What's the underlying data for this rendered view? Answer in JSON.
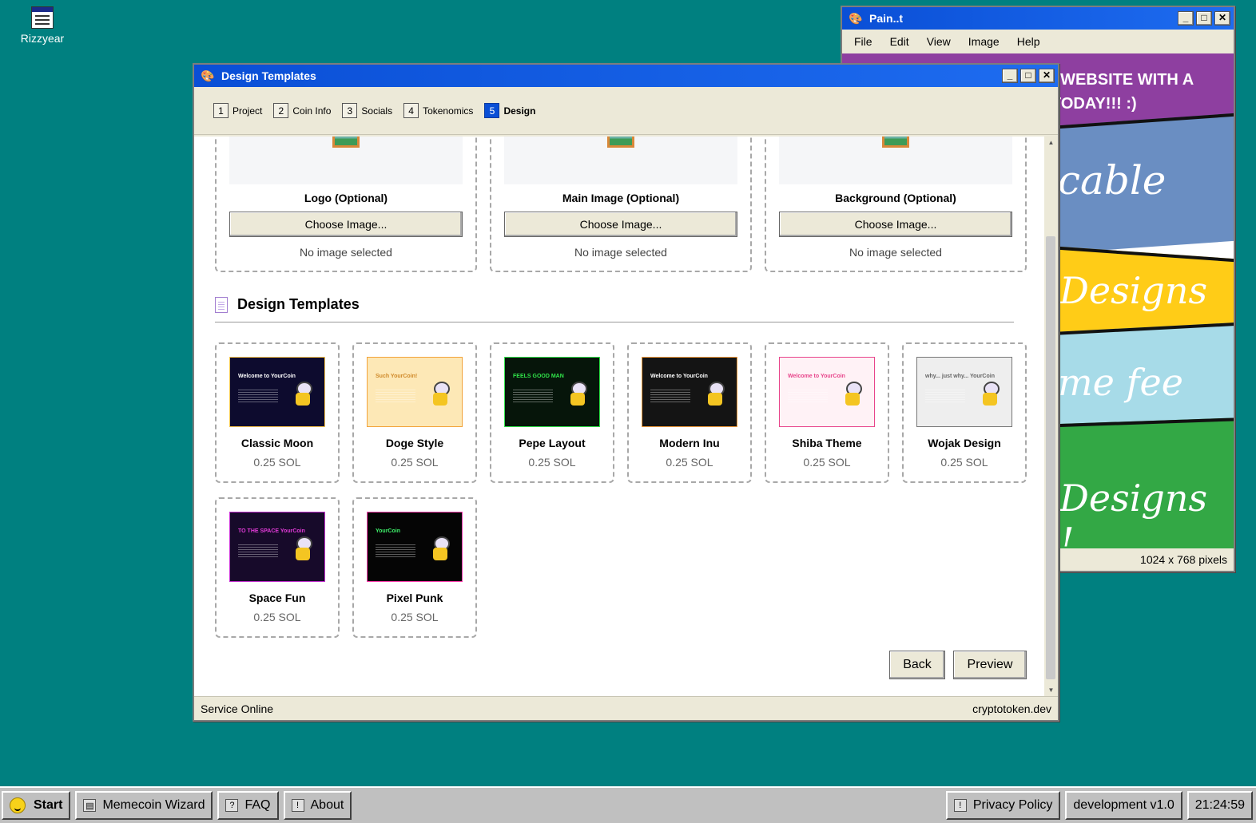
{
  "desktop": {
    "icon_label": "Rizzyear"
  },
  "paint": {
    "title": "Pain..t",
    "menu": [
      "File",
      "Edit",
      "View",
      "Image",
      "Help"
    ],
    "canvas_text": [
      "I WEBSITE WITH A",
      "TODAY!!! :)",
      "cable",
      "Designs",
      "me fee",
      "Designs !"
    ],
    "status": "1024 x 768 pixels",
    "band_colors": [
      "#8e3fa0",
      "#6a8ec2",
      "#ffcc17",
      "#a7dbe8",
      "#33a845"
    ]
  },
  "wizard": {
    "title": "Design Templates",
    "steps": [
      {
        "num": "1",
        "label": "Project"
      },
      {
        "num": "2",
        "label": "Coin Info"
      },
      {
        "num": "3",
        "label": "Socials"
      },
      {
        "num": "4",
        "label": "Tokenomics"
      },
      {
        "num": "5",
        "label": "Design"
      }
    ],
    "uploads": [
      {
        "title": "Logo (Optional)",
        "button": "Choose Image...",
        "note": "No image selected"
      },
      {
        "title": "Main Image (Optional)",
        "button": "Choose Image...",
        "note": "No image selected"
      },
      {
        "title": "Background (Optional)",
        "button": "Choose Image...",
        "note": "No image selected"
      }
    ],
    "section_title": "Design Templates",
    "templates": [
      {
        "name": "Classic Moon",
        "price": "0.25 SOL",
        "bg": "#0d0b2e",
        "fg": "#ffffff",
        "accent": "#f6c24a",
        "thumb_text": "Welcome to YourCoin"
      },
      {
        "name": "Doge Style",
        "price": "0.25 SOL",
        "bg": "#fde8b6",
        "fg": "#d08a2a",
        "accent": "#f2a33a",
        "thumb_text": "Such YourCoin!"
      },
      {
        "name": "Pepe Layout",
        "price": "0.25 SOL",
        "bg": "#06150a",
        "fg": "#31e34a",
        "accent": "#31e34a",
        "thumb_text": "FEELS GOOD MAN"
      },
      {
        "name": "Modern Inu",
        "price": "0.25 SOL",
        "bg": "#141414",
        "fg": "#ffffff",
        "accent": "#f39c3c",
        "thumb_text": "Welcome to YourCoin"
      },
      {
        "name": "Shiba Theme",
        "price": "0.25 SOL",
        "bg": "#fff2f6",
        "fg": "#e8458b",
        "accent": "#e8458b",
        "thumb_text": "Welcome to YourCoin"
      },
      {
        "name": "Wojak Design",
        "price": "0.25 SOL",
        "bg": "#eeeeee",
        "fg": "#666666",
        "accent": "#777777",
        "thumb_text": "why... just why... YourCoin"
      },
      {
        "name": "Space Fun",
        "price": "0.25 SOL",
        "bg": "#170a2a",
        "fg": "#e23bd8",
        "accent": "#c430d0",
        "thumb_text": "TO THE SPACE YourCoin"
      },
      {
        "name": "Pixel Punk",
        "price": "0.25 SOL",
        "bg": "#050505",
        "fg": "#3ef06a",
        "accent": "#ff3fb0",
        "thumb_text": "YourCoin"
      }
    ],
    "back_label": "Back",
    "preview_label": "Preview",
    "status_left": "Service Online",
    "status_right": "cryptotoken.dev"
  },
  "taskbar": {
    "start": "Start",
    "items": [
      "Memecoin Wizard",
      "FAQ",
      "About"
    ],
    "tray": [
      "Privacy Policy",
      "development v1.0",
      "21:24:59"
    ]
  }
}
